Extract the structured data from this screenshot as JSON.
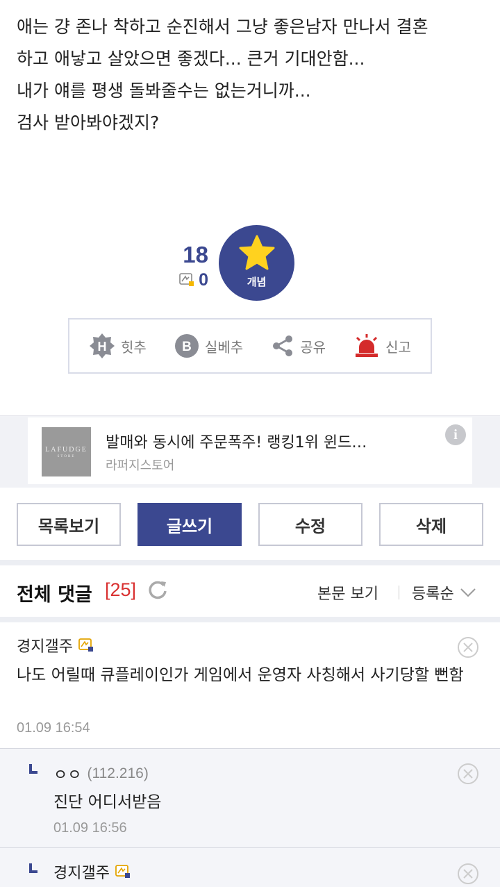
{
  "post": {
    "lines": [
      "애는 걍 존나 착하고 순진해서 그냥 좋은남자 만나서 결혼",
      "하고 애낳고 살았으면 좋겠다... 큰거 기대안함...",
      "내가 얘를 평생 돌봐줄수는 없는거니까...",
      "검사 받아봐야겠지?"
    ]
  },
  "recommend": {
    "count": "18",
    "fixed_count": "0",
    "button_label": "개념",
    "icons": [
      "star-icon",
      "gonic-icon"
    ]
  },
  "actions": [
    {
      "name": "hit-recommend",
      "label": "힛추",
      "icon": "hit-icon"
    },
    {
      "name": "best-recommend",
      "label": "실베추",
      "icon": "best-icon"
    },
    {
      "name": "share",
      "label": "공유",
      "icon": "share-icon"
    },
    {
      "name": "report",
      "label": "신고",
      "icon": "siren-icon"
    }
  ],
  "ad": {
    "logo_line1": "LAFUDGE",
    "logo_line2": "STORE",
    "title": "발매와 동시에 주문폭주! 랭킹1위 윈드…",
    "advertiser": "라퍼지스토어",
    "info_symbol": "i"
  },
  "buttons": {
    "list": "목록보기",
    "write": "글쓰기",
    "edit": "수정",
    "delete": "삭제"
  },
  "comments_header": {
    "title": "전체 댓글",
    "count": "[25]",
    "view_body": "본문 보기",
    "sort": "등록순"
  },
  "comments": [
    {
      "author": "경지갤주",
      "ip": "",
      "text": "나도 어릴때 큐플레이인가 게임에서 운영자 사칭해서 사기당할 뻔함",
      "date": "01.09 16:54",
      "reply": false
    },
    {
      "author": "ㅇㅇ",
      "ip": "(112.216)",
      "text": "진단 어디서받음",
      "date": "01.09 16:56",
      "reply": true
    },
    {
      "author": "경지갤주",
      "ip": "",
      "text": "",
      "date": "",
      "reply": true
    }
  ],
  "colors": {
    "brand": "#3b4890",
    "count_red": "#d93030",
    "siren_red": "#d42b2b"
  }
}
